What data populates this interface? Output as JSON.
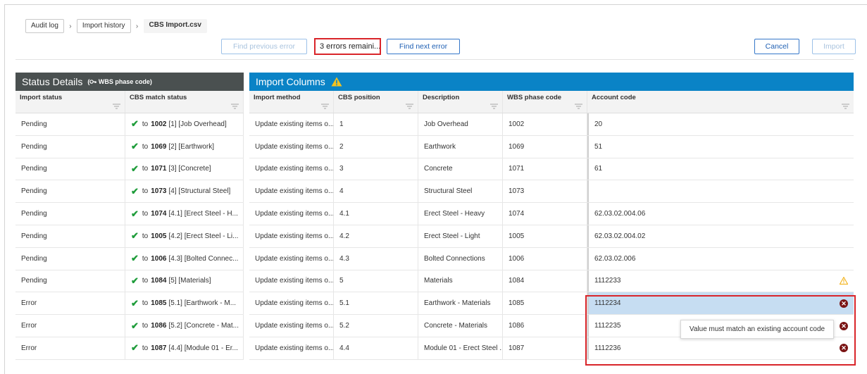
{
  "breadcrumb": [
    {
      "label": "Audit log"
    },
    {
      "label": "Import history"
    },
    {
      "label": "CBS Import.csv"
    }
  ],
  "toolbar": {
    "find_previous": "Find previous error",
    "errors_remaining": "3 errors remaini...",
    "find_next": "Find next error",
    "cancel": "Cancel",
    "import": "Import"
  },
  "status_panel": {
    "title": "Status Details",
    "subtitle": "WBS phase code",
    "columns": [
      "Import status",
      "CBS match status"
    ]
  },
  "import_panel": {
    "title": "Import Columns",
    "columns": [
      "Import method",
      "CBS position",
      "Description",
      "WBS phase code",
      "Account code"
    ]
  },
  "rows": [
    {
      "status": "Pending",
      "match_code": "1002",
      "match_rest": "[1] [Job Overhead]",
      "method": "Update existing items o...",
      "position": "1",
      "description": "Job Overhead",
      "wbs": "1002",
      "account": "20",
      "account_state": "ok"
    },
    {
      "status": "Pending",
      "match_code": "1069",
      "match_rest": "[2] [Earthwork]",
      "method": "Update existing items o...",
      "position": "2",
      "description": "Earthwork",
      "wbs": "1069",
      "account": "51",
      "account_state": "ok"
    },
    {
      "status": "Pending",
      "match_code": "1071",
      "match_rest": "[3] [Concrete]",
      "method": "Update existing items o...",
      "position": "3",
      "description": "Concrete",
      "wbs": "1071",
      "account": "61",
      "account_state": "ok"
    },
    {
      "status": "Pending",
      "match_code": "1073",
      "match_rest": "[4] [Structural Steel]",
      "method": "Update existing items o...",
      "position": "4",
      "description": "Structural Steel",
      "wbs": "1073",
      "account": "",
      "account_state": "ok"
    },
    {
      "status": "Pending",
      "match_code": "1074",
      "match_rest": "[4.1] [Erect Steel - H...",
      "method": "Update existing items o...",
      "position": "4.1",
      "description": "Erect Steel - Heavy",
      "wbs": "1074",
      "account": "62.03.02.004.06",
      "account_state": "ok"
    },
    {
      "status": "Pending",
      "match_code": "1005",
      "match_rest": "[4.2] [Erect Steel - Li...",
      "method": "Update existing items o...",
      "position": "4.2",
      "description": "Erect Steel - Light",
      "wbs": "1005",
      "account": "62.03.02.004.02",
      "account_state": "ok"
    },
    {
      "status": "Pending",
      "match_code": "1006",
      "match_rest": "[4.3] [Bolted Connec...",
      "method": "Update existing items o...",
      "position": "4.3",
      "description": "Bolted Connections",
      "wbs": "1006",
      "account": "62.03.02.006",
      "account_state": "ok"
    },
    {
      "status": "Pending",
      "match_code": "1084",
      "match_rest": "[5] [Materials]",
      "method": "Update existing items o...",
      "position": "5",
      "description": "Materials",
      "wbs": "1084",
      "account": "1112233",
      "account_state": "warning"
    },
    {
      "status": "Error",
      "match_code": "1085",
      "match_rest": "[5.1] [Earthwork - M...",
      "method": "Update existing items o...",
      "position": "5.1",
      "description": "Earthwork - Materials",
      "wbs": "1085",
      "account": "1112234",
      "account_state": "error-selected"
    },
    {
      "status": "Error",
      "match_code": "1086",
      "match_rest": "[5.2] [Concrete - Mat...",
      "method": "Update existing items o...",
      "position": "5.2",
      "description": "Concrete - Materials",
      "wbs": "1086",
      "account": "1112235",
      "account_state": "error"
    },
    {
      "status": "Error",
      "match_code": "1087",
      "match_rest": "[4.4] [Module 01 - Er...",
      "method": "Update existing items o...",
      "position": "4.4",
      "description": "Module 01 - Erect Steel ...",
      "wbs": "1087",
      "account": "1112236",
      "account_state": "error"
    }
  ],
  "match_prefix": "to",
  "tooltip": "Value must match an existing account code",
  "colors": {
    "status_band": "#4a5050",
    "import_band": "#0a83c6",
    "error_outline": "#d9252a",
    "selected_cell": "#c6ddf2",
    "check": "#1e9c3a",
    "error_icon": "#7a1414",
    "warning_icon": "#f2b21a"
  },
  "icons": {
    "breadcrumb_separator": "chevron-right-icon",
    "column_filter": "filter-icon",
    "match": "check-icon",
    "row_error": "error-circle-icon",
    "row_warning": "warning-triangle-icon",
    "header_warning": "warning-triangle-icon",
    "wbs_key": "key-icon"
  }
}
